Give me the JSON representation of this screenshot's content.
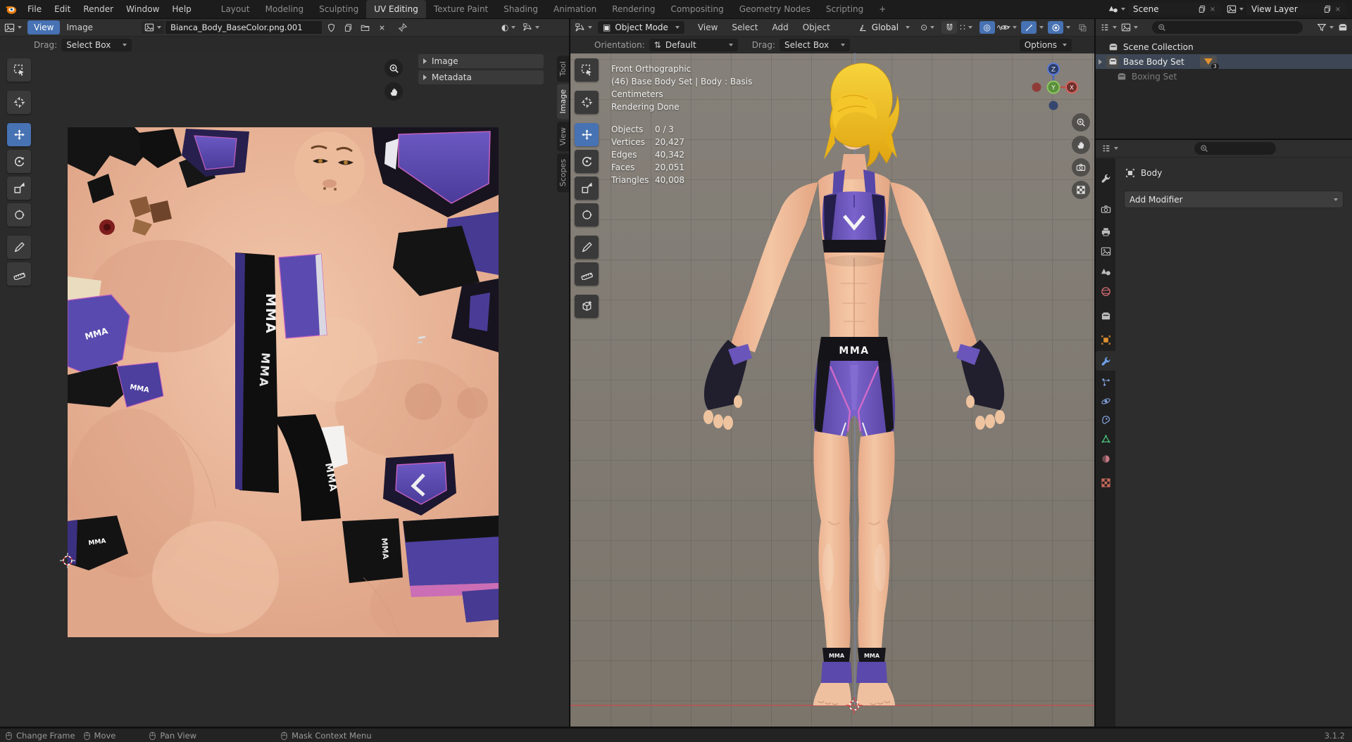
{
  "topbar": {
    "menus": [
      "File",
      "Edit",
      "Render",
      "Window",
      "Help"
    ],
    "tabs": [
      "Layout",
      "Modeling",
      "Sculpting",
      "UV Editing",
      "Texture Paint",
      "Shading",
      "Animation",
      "Rendering",
      "Compositing",
      "Geometry Nodes",
      "Scripting"
    ],
    "active_tab_index": 3,
    "new_tab": "+",
    "scene_name": "Scene",
    "view_layer_name": "View Layer"
  },
  "uv": {
    "menu_view": "View",
    "menu_image": "Image",
    "image_name": "Bianca_Body_BaseColor.png.001",
    "drag_label": "Drag:",
    "drag_value": "Select Box",
    "panel_image": "Image",
    "panel_metadata": "Metadata",
    "sidebar_tabs": [
      "Tool",
      "Image",
      "View",
      "Scopes"
    ],
    "active_sidebar_tab": "Image"
  },
  "viewport": {
    "mode": "Object Mode",
    "menus": [
      "View",
      "Select",
      "Add",
      "Object"
    ],
    "orientation": "Global",
    "row2": {
      "orientation_label": "Orientation:",
      "orientation_value": "Default",
      "drag_label": "Drag:",
      "drag_value": "Select Box",
      "options": "Options"
    },
    "overlay": {
      "line1": "Front Orthographic",
      "line2": "(46) Base Body Set | Body : Basis",
      "line3": "Centimeters",
      "line4": "Rendering Done",
      "stats": [
        {
          "label": "Objects",
          "value": "0 / 3"
        },
        {
          "label": "Vertices",
          "value": "20,427"
        },
        {
          "label": "Edges",
          "value": "40,342"
        },
        {
          "label": "Faces",
          "value": "20,051"
        },
        {
          "label": "Triangles",
          "value": "40,008"
        }
      ]
    },
    "gizmo": {
      "z": "Z",
      "x": "X",
      "y": "Y"
    }
  },
  "outliner": {
    "scene_collection": "Scene Collection",
    "base_body_set": "Base Body Set",
    "base_body_badge": "3",
    "boxing_set": "Boxing Set"
  },
  "properties": {
    "object_name": "Body",
    "add_modifier": "Add Modifier"
  },
  "statusbar": {
    "items": [
      "Change Frame",
      "Move",
      "Pan View",
      "Mask Context Menu"
    ],
    "version": "3.1.2"
  },
  "artwork": {
    "brand": "MMA"
  },
  "colors": {
    "accent": "#4772b3",
    "viewport_bg": "#7e7970",
    "axis_x": "#bb5450",
    "hair": "#eebc1e",
    "outfit_purple": "#6950b8",
    "trim_pink": "#d06ac8"
  }
}
